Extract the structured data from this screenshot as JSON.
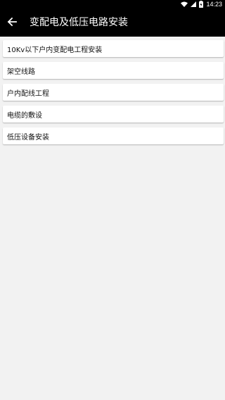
{
  "status_bar": {
    "time": "14:23",
    "icons": [
      "wifi-icon",
      "signal-icon",
      "battery-charging-icon"
    ]
  },
  "app_bar": {
    "back_icon": "arrow-left-icon",
    "title": "变配电及低压电路安装"
  },
  "list": {
    "items": [
      {
        "label": "10Kv以下户内变配电工程安装"
      },
      {
        "label": "架空线路"
      },
      {
        "label": "户内配线工程"
      },
      {
        "label": "电缆的敷设"
      },
      {
        "label": "低压设备安装"
      }
    ]
  }
}
